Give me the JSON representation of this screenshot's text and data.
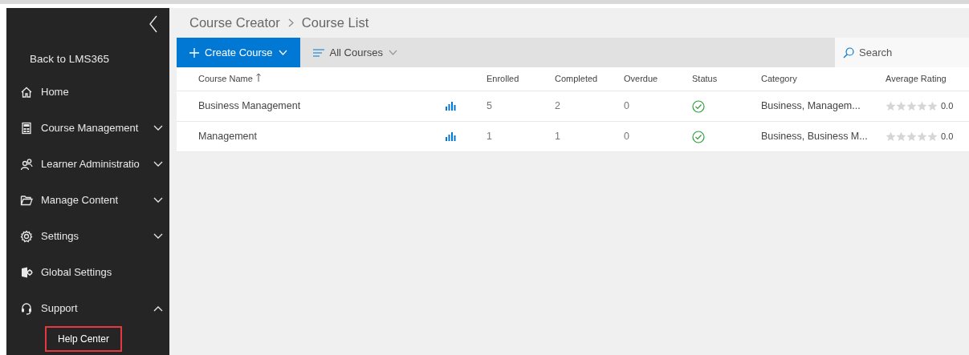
{
  "sidebar": {
    "back_link": "Back to LMS365",
    "items": [
      {
        "label": "Home"
      },
      {
        "label": "Course Management",
        "expanded": false
      },
      {
        "label": "Learner Administratio",
        "expanded": false
      },
      {
        "label": "Manage Content",
        "expanded": false
      },
      {
        "label": "Settings",
        "expanded": false
      },
      {
        "label": "Global Settings"
      },
      {
        "label": "Support",
        "expanded": true,
        "children": [
          {
            "label": "Help Center",
            "highlighted": true
          }
        ]
      }
    ]
  },
  "breadcrumb": [
    "Course Creator",
    "Course List"
  ],
  "toolbar": {
    "create_button": "Create Course",
    "filter": "All Courses",
    "search": {
      "placeholder": "Search"
    }
  },
  "table": {
    "columns": [
      {
        "label": "Course Name",
        "sorted": true
      },
      {
        "label": "Enrolled",
        "sorted": false
      },
      {
        "label": "Completed",
        "sorted": false
      },
      {
        "label": "Overdue",
        "sorted": false
      },
      {
        "label": "Status",
        "sorted": false
      },
      {
        "label": "Category",
        "sorted": false
      },
      {
        "label": "Average Rating",
        "sorted": false
      }
    ],
    "rows": [
      {
        "name": "Business Management",
        "enrolled": "5",
        "completed": "2",
        "overdue": "0",
        "active": true,
        "category": "Business, Managem...",
        "stars": 0,
        "rating": "0.0"
      },
      {
        "name": "Management",
        "enrolled": "1",
        "completed": "1",
        "overdue": "0",
        "active": true,
        "category": "Business, Business M...",
        "stars": 0,
        "rating": "0.0"
      }
    ]
  }
}
